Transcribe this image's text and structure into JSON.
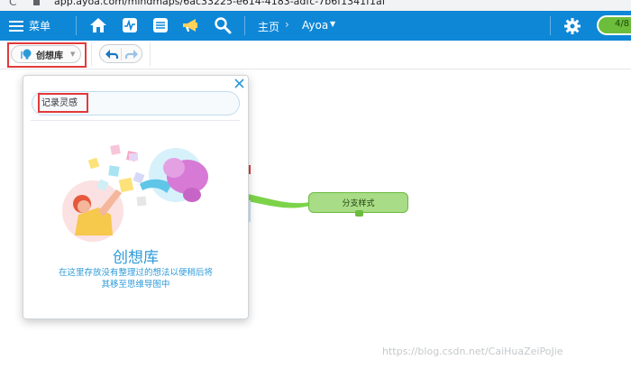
{
  "browser": {
    "url": "app.ayoa.com/mindmaps/6ac33225-e614-4183-adfc-7b6f1341f1af"
  },
  "topbar": {
    "menu_label": "菜单",
    "breadcrumb_home": "主页",
    "breadcrumb_separator": "›",
    "breadcrumb_current": "Ayoa",
    "tasks_badge": "4/8 ⁞",
    "accent_color": "#0f87d7"
  },
  "toolbar": {
    "ideas_label": "创想库",
    "ideas_dropdown_icon": "chevron-down-icon"
  },
  "ideas_panel": {
    "input_placeholder": "记录灵感",
    "empty_title": "创想库",
    "empty_description_line1": "在这里存放没有整理过的想法以便稍后将",
    "empty_description_line2": "其移至思维导图中"
  },
  "canvas": {
    "branch_label": "分支样式",
    "branch_color": "#a8dc86"
  },
  "watermark": "https://blog.csdn.net/CaiHuaZeiPoJie",
  "icons": [
    "menu-icon",
    "home-icon",
    "pulse-icon",
    "task-list-icon",
    "megaphone-icon",
    "search-icon",
    "gear-icon",
    "lightbulb-icon",
    "undo-icon",
    "redo-icon",
    "close-icon"
  ]
}
